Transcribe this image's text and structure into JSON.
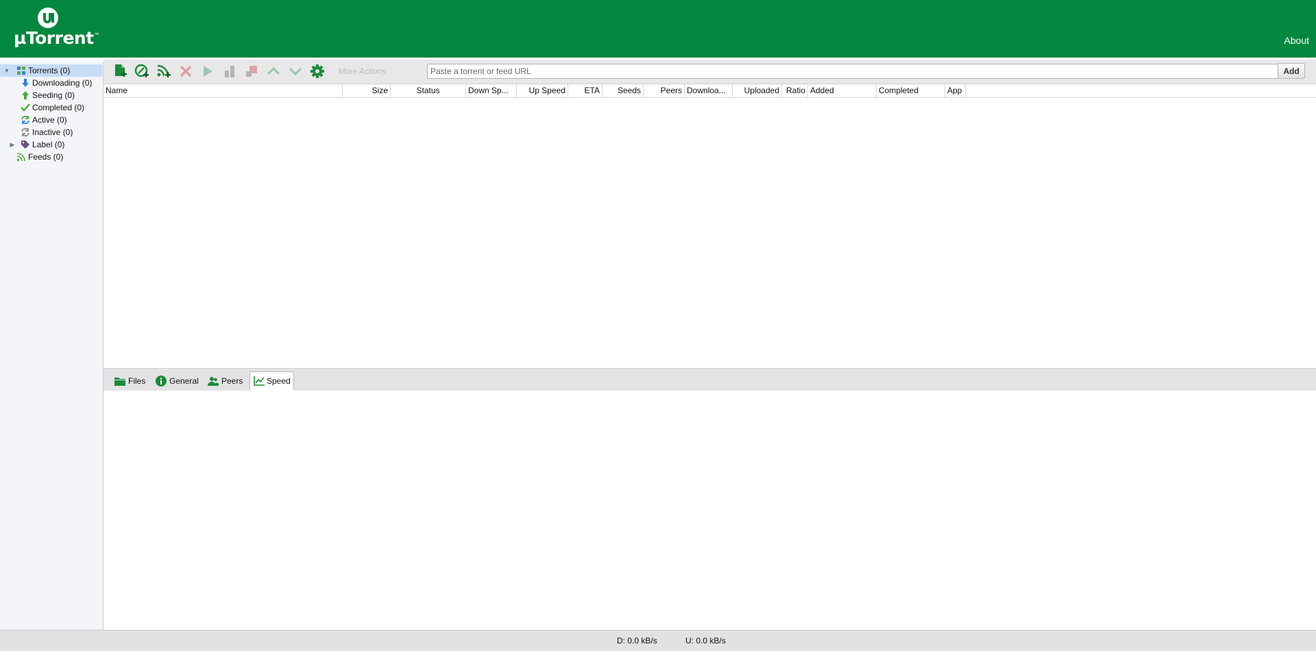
{
  "app": {
    "logo_text": "µTorrent",
    "logo_tm": "™",
    "about_link": "About"
  },
  "sidebar": {
    "items": [
      {
        "label": "Torrents (0)",
        "icon": "torrents-icon",
        "selected": true
      },
      {
        "label": "Downloading (0)",
        "icon": "download-arrow-icon"
      },
      {
        "label": "Seeding (0)",
        "icon": "upload-arrow-icon"
      },
      {
        "label": "Completed (0)",
        "icon": "checkmark-icon"
      },
      {
        "label": "Active (0)",
        "icon": "refresh-arrows-icon"
      },
      {
        "label": "Inactive (0)",
        "icon": "refresh-arrows-gray-icon"
      },
      {
        "label": "Label (0)",
        "icon": "tag-icon"
      },
      {
        "label": "Feeds (0)",
        "icon": "rss-icon"
      }
    ]
  },
  "toolbar": {
    "buttons": [
      {
        "name": "add-torrent",
        "icon": "add-torrent-file-icon",
        "enabled": true
      },
      {
        "name": "add-torrent-url",
        "icon": "add-torrent-link-icon",
        "enabled": true
      },
      {
        "name": "add-rss-feed",
        "icon": "add-rss-icon",
        "enabled": true
      },
      {
        "name": "remove",
        "icon": "remove-x-icon",
        "enabled": false
      },
      {
        "name": "start",
        "icon": "play-icon",
        "enabled": false
      },
      {
        "name": "pause",
        "icon": "pause-icon",
        "enabled": false
      },
      {
        "name": "stop",
        "icon": "stop-icon",
        "enabled": false
      },
      {
        "name": "move-up",
        "icon": "chevron-up-icon",
        "enabled": false
      },
      {
        "name": "move-down",
        "icon": "chevron-down-icon",
        "enabled": false
      },
      {
        "name": "settings",
        "icon": "gear-icon",
        "enabled": true
      }
    ],
    "more_actions_label": "More Actions",
    "url_placeholder": "Paste a torrent or feed URL",
    "add_button_label": "Add"
  },
  "list": {
    "columns": [
      "Name",
      "Size",
      "Status",
      "Down Sp...",
      "Up Speed",
      "ETA",
      "Seeds",
      "Peers",
      "Downloa...",
      "Uploaded",
      "Ratio",
      "Added",
      "Completed",
      "App"
    ],
    "rows": []
  },
  "detail_tabs": [
    {
      "label": "Files",
      "icon": "folder-icon"
    },
    {
      "label": "General",
      "icon": "info-icon"
    },
    {
      "label": "Peers",
      "icon": "peers-icon"
    },
    {
      "label": "Speed",
      "icon": "speed-chart-icon",
      "active": true
    }
  ],
  "status": {
    "download": "D: 0.0 kB/s",
    "upload": "U: 0.0 kB/s"
  },
  "colors": {
    "brand_green": "#01873e",
    "selection_blue": "#c7dcf5",
    "icon_green": "#1a8b3a"
  }
}
